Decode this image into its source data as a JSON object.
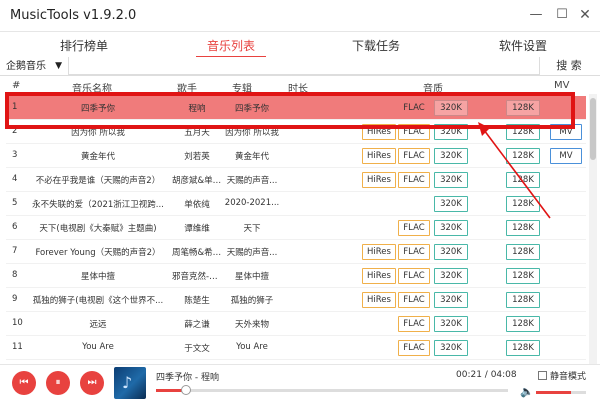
{
  "window": {
    "title": "MusicTools v1.9.2.0",
    "minimize": "—",
    "maximize": "☐",
    "close": "✕"
  },
  "tabs": [
    {
      "label": "排行榜单"
    },
    {
      "label": "音乐列表"
    },
    {
      "label": "下载任务"
    },
    {
      "label": "软件设置"
    }
  ],
  "active_tab": 1,
  "toolbar": {
    "source": "企鹅音乐",
    "search_placeholder": "",
    "search_button": "搜 索"
  },
  "columns": {
    "number": "#",
    "title": "音乐名称",
    "artist": "歌手",
    "album": "专辑",
    "duration": "时长",
    "quality": "音质",
    "mv": "MV"
  },
  "songs": [
    {
      "no": "1",
      "title": "四季予你",
      "artist": "程响",
      "album": "四季予你",
      "hires": "",
      "flac": "FLAC",
      "q320": "320K",
      "q128": "128K",
      "mv": "",
      "selected": true
    },
    {
      "no": "2",
      "title": "因为你 所以我",
      "artist": "五月天",
      "album": "因为你 所以我",
      "hires": "HiRes",
      "flac": "FLAC",
      "q320": "320K",
      "q128": "128K",
      "mv": "MV"
    },
    {
      "no": "3",
      "title": "黄金年代",
      "artist": "刘若英",
      "album": "黄金年代",
      "hires": "HiRes",
      "flac": "FLAC",
      "q320": "320K",
      "q128": "128K",
      "mv": "MV"
    },
    {
      "no": "4",
      "title": "不必在乎我是谁（天赐的声音2）",
      "artist": "胡彦斌&单依...",
      "album": "天赐的声音...",
      "hires": "HiRes",
      "flac": "FLAC",
      "q320": "320K",
      "q128": "128K",
      "mv": ""
    },
    {
      "no": "5",
      "title": "永不失联的爱（2021浙江卫视跨...",
      "artist": "单依纯",
      "album": "2020-2021...",
      "hires": "",
      "flac": "",
      "q320": "320K",
      "q128": "128K",
      "mv": ""
    },
    {
      "no": "6",
      "title": "天下(电视剧《大秦赋》主题曲)",
      "artist": "谭维维",
      "album": "天下",
      "hires": "",
      "flac": "FLAC",
      "q320": "320K",
      "q128": "128K",
      "mv": ""
    },
    {
      "no": "7",
      "title": "Forever Young（天赐的声音2）",
      "artist": "周笔畅&希林娜",
      "album": "天赐的声音...",
      "hires": "HiRes",
      "flac": "FLAC",
      "q320": "320K",
      "q128": "128K",
      "mv": ""
    },
    {
      "no": "8",
      "title": "星体中擅",
      "artist": "邪音克然-N...",
      "album": "星体中擅",
      "hires": "HiRes",
      "flac": "FLAC",
      "q320": "320K",
      "q128": "128K",
      "mv": ""
    },
    {
      "no": "9",
      "title": "孤独的狮子(电视剧《这个世界不...",
      "artist": "陈楚生",
      "album": "孤独的狮子",
      "hires": "HiRes",
      "flac": "FLAC",
      "q320": "320K",
      "q128": "128K",
      "mv": ""
    },
    {
      "no": "10",
      "title": "远远",
      "artist": "薛之谦",
      "album": "天外来物",
      "hires": "",
      "flac": "FLAC",
      "q320": "320K",
      "q128": "128K",
      "mv": ""
    },
    {
      "no": "11",
      "title": "You Are",
      "artist": "于文文",
      "album": "You Are",
      "hires": "",
      "flac": "FLAC",
      "q320": "320K",
      "q128": "128K",
      "mv": ""
    }
  ],
  "player": {
    "prev_icon": "⏮",
    "play_icon": "⏸",
    "next_icon": "⏭",
    "cover_icon": "♪",
    "now_playing": "四季予你 - 程响",
    "time": "00:21 / 04:08",
    "progress": 0.085,
    "mute_label": "静音模式",
    "volume_icon": "🔈",
    "volume": 0.7
  },
  "colors": {
    "accent": "#e8423f",
    "selected_row": "#f07b7b",
    "annotation": "#e01414"
  }
}
